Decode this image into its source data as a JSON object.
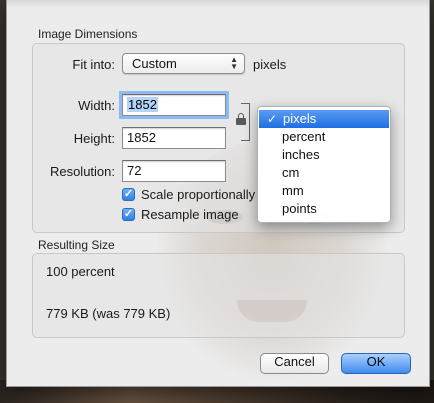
{
  "dialog": {
    "image_dimensions_label": "Image Dimensions",
    "fit_into_label": "Fit into:",
    "fit_into_value": "Custom",
    "fit_into_units": "pixels",
    "width_label": "Width:",
    "width_value": "1852",
    "height_label": "Height:",
    "height_value": "1852",
    "resolution_label": "Resolution:",
    "resolution_value": "72",
    "scale_proportionally_label": "Scale proportionally",
    "scale_proportionally_checked": true,
    "resample_label": "Resample image",
    "resample_checked": true,
    "resulting_size_label": "Resulting Size",
    "resulting_percent": "100 percent",
    "resulting_size": "779 KB (was 779 KB)",
    "cancel_label": "Cancel",
    "ok_label": "OK"
  },
  "units_menu": {
    "checkmark": "✓",
    "items": [
      "pixels",
      "percent",
      "inches",
      "cm",
      "mm",
      "points"
    ],
    "selected_index": 0
  },
  "icons": {
    "popup": "popup-arrows-icon",
    "lock": "lock-icon",
    "check": "checkmark-icon"
  },
  "colors": {
    "accent": "#1f6fe3",
    "selection": "#b3d3f8",
    "sheet_bg": "#ececec"
  }
}
